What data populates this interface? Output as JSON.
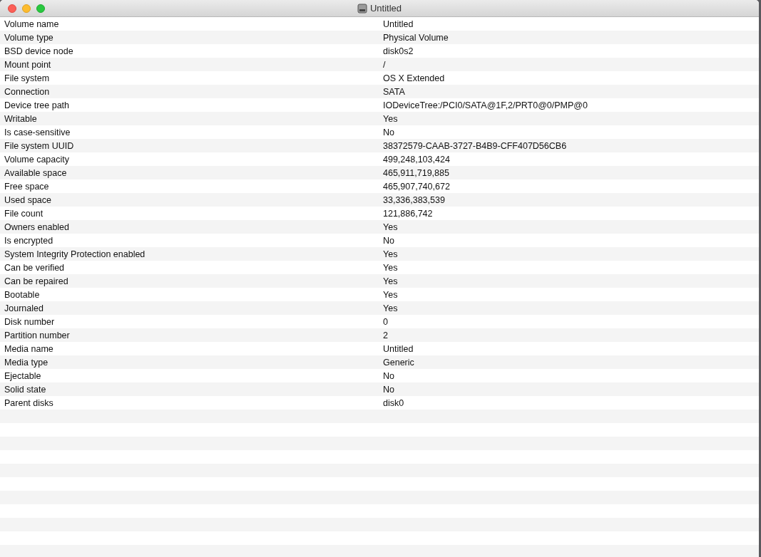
{
  "window": {
    "title": "Untitled"
  },
  "rows": [
    {
      "label": "Volume name",
      "value": "Untitled"
    },
    {
      "label": "Volume type",
      "value": "Physical Volume"
    },
    {
      "label": "BSD device node",
      "value": "disk0s2"
    },
    {
      "label": "Mount point",
      "value": "/"
    },
    {
      "label": "File system",
      "value": "OS X Extended"
    },
    {
      "label": "Connection",
      "value": "SATA"
    },
    {
      "label": "Device tree path",
      "value": "IODeviceTree:/PCI0/SATA@1F,2/PRT0@0/PMP@0"
    },
    {
      "label": "Writable",
      "value": "Yes"
    },
    {
      "label": "Is case-sensitive",
      "value": "No"
    },
    {
      "label": "File system UUID",
      "value": "38372579-CAAB-3727-B4B9-CFF407D56CB6"
    },
    {
      "label": "Volume capacity",
      "value": "499,248,103,424"
    },
    {
      "label": "Available space",
      "value": "465,911,719,885"
    },
    {
      "label": "Free space",
      "value": "465,907,740,672"
    },
    {
      "label": "Used space",
      "value": "33,336,383,539"
    },
    {
      "label": "File count",
      "value": "121,886,742"
    },
    {
      "label": "Owners enabled",
      "value": "Yes"
    },
    {
      "label": "Is encrypted",
      "value": "No"
    },
    {
      "label": "System Integrity Protection enabled",
      "value": "Yes"
    },
    {
      "label": "Can be verified",
      "value": "Yes"
    },
    {
      "label": "Can be repaired",
      "value": "Yes"
    },
    {
      "label": "Bootable",
      "value": "Yes"
    },
    {
      "label": "Journaled",
      "value": "Yes"
    },
    {
      "label": "Disk number",
      "value": "0"
    },
    {
      "label": "Partition number",
      "value": "2"
    },
    {
      "label": "Media name",
      "value": "Untitled"
    },
    {
      "label": "Media type",
      "value": "Generic"
    },
    {
      "label": "Ejectable",
      "value": "No"
    },
    {
      "label": "Solid state",
      "value": "No"
    },
    {
      "label": "Parent disks",
      "value": "disk0"
    }
  ]
}
